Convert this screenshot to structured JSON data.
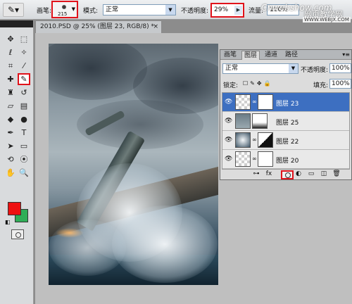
{
  "options_bar": {
    "tool_icon": "brush-icon",
    "brush_label": "画笔:",
    "brush_size": "215",
    "mode_label": "模式:",
    "mode_value": "正常",
    "opacity_label": "不透明度:",
    "opacity_value": "29%",
    "flow_label": "流量:",
    "flow_value": "100%"
  },
  "watermark": {
    "line1": "Cnwebshow.com",
    "line2": "网页教学网",
    "line3": "WWW.WEBJX.COM"
  },
  "document": {
    "tab_title": "2010.PSD @ 25% (图层 23, RGB/8) *",
    "close_glyph": "×"
  },
  "toolbox": {
    "tools": [
      "move-icon",
      "marquee-icon",
      "lasso-icon",
      "magic-wand-icon",
      "crop-icon",
      "eyedropper-icon",
      "healing-icon",
      "brush-icon",
      "stamp-icon",
      "history-brush-icon",
      "eraser-icon",
      "gradient-icon",
      "blur-icon",
      "dodge-icon",
      "pen-icon",
      "type-icon",
      "path-select-icon",
      "shape-icon",
      "3d-rotate-icon",
      "3d-camera-icon",
      "hand-icon",
      "zoom-icon"
    ],
    "foreground_color": "#ee1111",
    "background_color": "#2fae57"
  },
  "layers_panel": {
    "tabs": [
      "画笔",
      "图层",
      "通道",
      "路径"
    ],
    "active_tab": "图层",
    "blend_mode": "正常",
    "opacity_label": "不透明度:",
    "opacity_value": "100%",
    "lock_label": "锁定:",
    "fill_label": "填充:",
    "fill_value": "100%",
    "layers": [
      {
        "name": "图层 23",
        "selected": true
      },
      {
        "name": "图层 25",
        "selected": false
      },
      {
        "name": "图层 22",
        "selected": false
      },
      {
        "name": "图层 20",
        "selected": false
      }
    ],
    "bottom_icons": [
      "link-icon",
      "fx-icon",
      "add-mask-icon",
      "adjustment-icon",
      "group-icon",
      "new-layer-icon",
      "trash-icon"
    ]
  }
}
